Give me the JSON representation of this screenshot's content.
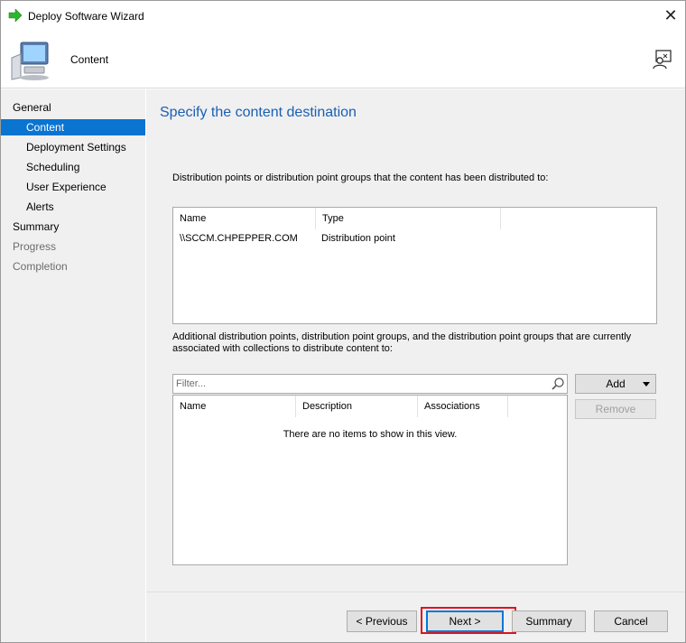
{
  "window": {
    "title": "Deploy Software Wizard",
    "close_glyph": "✕"
  },
  "header": {
    "page_name": "Content"
  },
  "sidebar": {
    "items": [
      {
        "label": "General",
        "state": "normal"
      },
      {
        "label": "Content",
        "state": "active"
      },
      {
        "label": "Deployment Settings",
        "state": "normal"
      },
      {
        "label": "Scheduling",
        "state": "normal"
      },
      {
        "label": "User Experience",
        "state": "normal"
      },
      {
        "label": "Alerts",
        "state": "normal"
      },
      {
        "label": "Summary",
        "state": "normal"
      },
      {
        "label": "Progress",
        "state": "disabled"
      },
      {
        "label": "Completion",
        "state": "disabled"
      }
    ]
  },
  "main": {
    "heading": "Specify the content destination",
    "distributed_label": "Distribution points or distribution point groups that the content has been distributed to:",
    "distributed_table": {
      "columns": [
        "Name",
        "Type"
      ],
      "rows": [
        [
          "\\\\SCCM.CHPEPPER.COM",
          "Distribution point"
        ]
      ]
    },
    "additional_label_line1": "Additional distribution points, distribution point groups, and the distribution point groups that are currently",
    "additional_label_line2": "associated with collections to distribute content to:",
    "filter_placeholder": "Filter...",
    "add_label": "Add",
    "remove_label": "Remove",
    "additional_table": {
      "columns": [
        "Name",
        "Description",
        "Associations"
      ],
      "empty_message": "There are no items to show in this view."
    }
  },
  "footer": {
    "previous_label": "< Previous",
    "next_label": "Next >",
    "summary_label": "Summary",
    "cancel_label": "Cancel"
  },
  "colors": {
    "accent": "#0a74d1",
    "heading": "#1a5fb4",
    "highlight": "#e0131c",
    "arrow_icon": "#2db52d"
  },
  "icons": {
    "title_icon": "green-arrow-icon",
    "header_icon": "computer-icon",
    "help_icon": "help-user-icon",
    "filter_icon": "search-icon",
    "add_dropdown_icon": "chevron-down-icon"
  }
}
